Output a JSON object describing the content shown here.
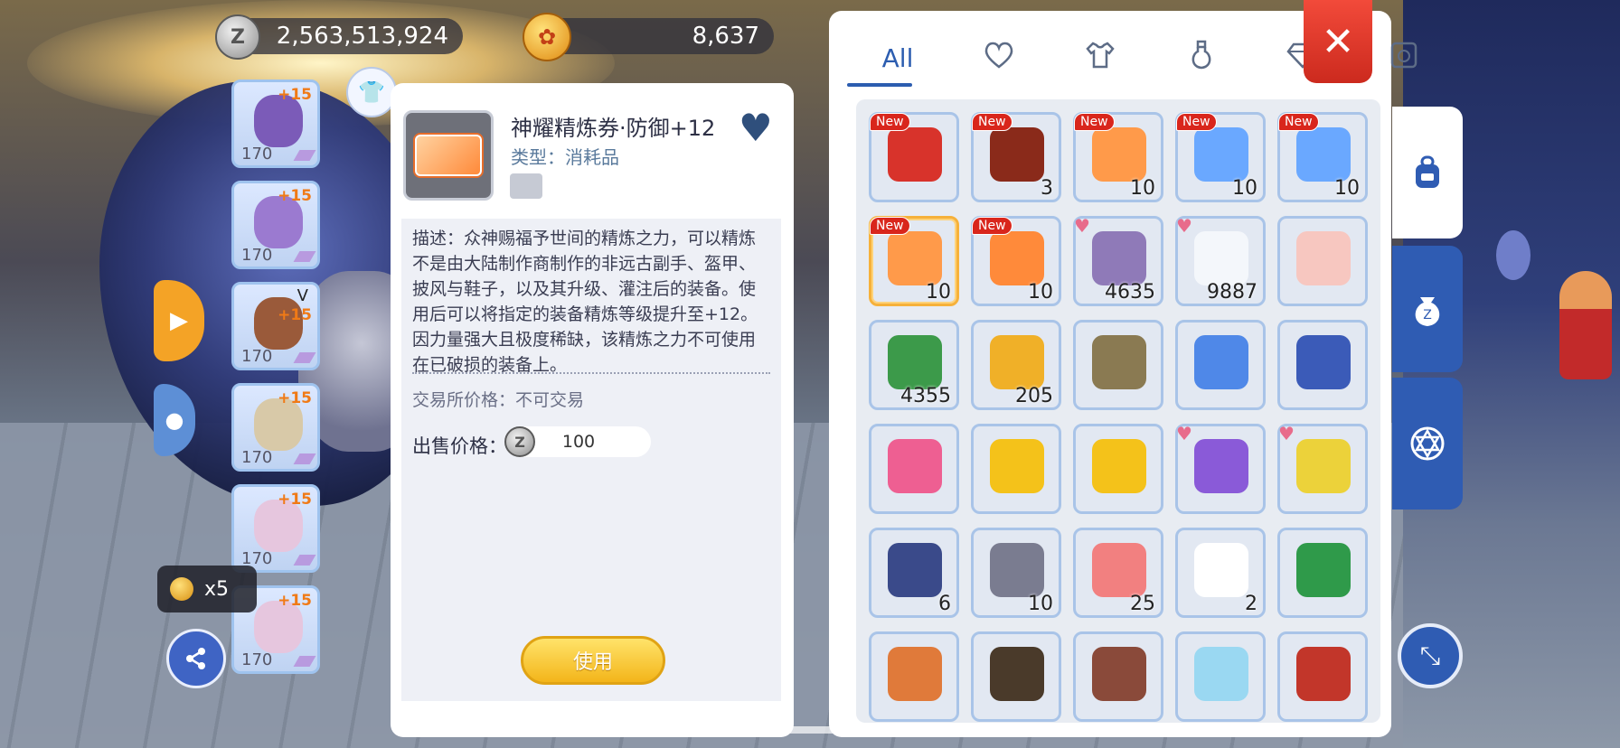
{
  "currency": {
    "zeny_icon": "zeny-coin-icon",
    "zeny_glyph": "Z",
    "zeny": "2,563,513,924",
    "gold_icon": "gold-coin-icon",
    "gold": "8,637"
  },
  "equipment": [
    {
      "name": "equip-slot-headgear",
      "level": "170",
      "refine": "+15",
      "color": "#7b5bb8"
    },
    {
      "name": "equip-slot-armor",
      "level": "170",
      "refine": "+15",
      "color": "#9b7ad0"
    },
    {
      "name": "equip-slot-garment",
      "level": "170",
      "refine": "+15",
      "mark": "V",
      "color": "#9a5a3a"
    },
    {
      "name": "equip-slot-shoes",
      "level": "170",
      "refine": "+15",
      "color": "#d8c9a8"
    },
    {
      "name": "equip-slot-accessory-1",
      "level": "170",
      "refine": "+15",
      "color": "#e6c6de"
    },
    {
      "name": "equip-slot-accessory-2",
      "level": "170",
      "refine": "+15",
      "color": "#e6c6de"
    }
  ],
  "coin_tip": {
    "count": "x5"
  },
  "detail": {
    "title": "神耀精炼券·防御+12",
    "type": "类型：消耗品",
    "description": "描述：众神赐福予世间的精炼之力，可以精炼不是由大陆制作商制作的非远古副手、盔甲、披风与鞋子，以及其升级、灌注后的装备。使用后可以将指定的装备精炼等级提升至+12。因力量强大且极度稀缺，该精炼之力不可使用在已破损的装备上。",
    "trade": "交易所价格：不可交易",
    "sell_label": "出售价格：",
    "sell_price": "100",
    "use_label": "使用"
  },
  "inventory": {
    "tabs": [
      {
        "name": "tab-all",
        "label": "All",
        "icon": ""
      },
      {
        "name": "tab-favorites",
        "label": "",
        "icon": "heart-icon"
      },
      {
        "name": "tab-equipment",
        "label": "",
        "icon": "shirt-icon"
      },
      {
        "name": "tab-consumables",
        "label": "",
        "icon": "potion-icon"
      },
      {
        "name": "tab-gems",
        "label": "",
        "icon": "diamond-icon"
      },
      {
        "name": "tab-cards",
        "label": "",
        "icon": "card-icon"
      }
    ],
    "close_icon": "close-icon",
    "items": [
      {
        "new": true,
        "fav": false,
        "qty": "",
        "color": "#d8332b"
      },
      {
        "new": true,
        "fav": false,
        "qty": "3",
        "color": "#8a2a1a"
      },
      {
        "new": true,
        "fav": false,
        "qty": "10",
        "color": "#ff9a4a"
      },
      {
        "new": true,
        "fav": false,
        "qty": "10",
        "color": "#6aa8ff"
      },
      {
        "new": true,
        "fav": false,
        "qty": "10",
        "color": "#6aa8ff"
      },
      {
        "new": true,
        "fav": false,
        "qty": "10",
        "color": "#ff9a4a",
        "selected": true
      },
      {
        "new": true,
        "fav": false,
        "qty": "10",
        "color": "#ff8a3a"
      },
      {
        "new": false,
        "fav": true,
        "qty": "4635",
        "color": "#8f7ab8"
      },
      {
        "new": false,
        "fav": true,
        "qty": "9887",
        "color": "#f4f7fb"
      },
      {
        "new": false,
        "fav": false,
        "qty": "",
        "color": "#f7c7c0"
      },
      {
        "new": false,
        "fav": false,
        "qty": "4355",
        "color": "#3c9a4a"
      },
      {
        "new": false,
        "fav": false,
        "qty": "205",
        "color": "#f0b028"
      },
      {
        "new": false,
        "fav": false,
        "qty": "",
        "color": "#8a7a52"
      },
      {
        "new": false,
        "fav": false,
        "qty": "",
        "color": "#4f88e8"
      },
      {
        "new": false,
        "fav": false,
        "qty": "",
        "color": "#3b5bb8"
      },
      {
        "new": false,
        "fav": false,
        "qty": "",
        "color": "#ee5f92"
      },
      {
        "new": false,
        "fav": false,
        "qty": "",
        "color": "#f4c21a"
      },
      {
        "new": false,
        "fav": false,
        "qty": "",
        "color": "#f4c21a"
      },
      {
        "new": false,
        "fav": true,
        "qty": "",
        "color": "#8a5ad8"
      },
      {
        "new": false,
        "fav": true,
        "qty": "",
        "color": "#ecd23a"
      },
      {
        "new": false,
        "fav": false,
        "qty": "6",
        "color": "#3a4a8a"
      },
      {
        "new": false,
        "fav": false,
        "qty": "10",
        "color": "#7a7c90"
      },
      {
        "new": false,
        "fav": false,
        "qty": "25",
        "color": "#f28080"
      },
      {
        "new": false,
        "fav": false,
        "qty": "2",
        "color": "#ffffff"
      },
      {
        "new": false,
        "fav": false,
        "qty": "",
        "color": "#2f9a4a"
      },
      {
        "new": false,
        "fav": false,
        "qty": "",
        "color": "#e07a3a"
      },
      {
        "new": false,
        "fav": false,
        "qty": "",
        "color": "#4a3a2a"
      },
      {
        "new": false,
        "fav": false,
        "qty": "",
        "color": "#8a4a3a"
      },
      {
        "new": false,
        "fav": false,
        "qty": "",
        "color": "#9ad8f2"
      },
      {
        "new": false,
        "fav": false,
        "qty": "",
        "color": "#c2362a"
      }
    ],
    "new_label": "New"
  },
  "side_tabs": [
    {
      "name": "bag-tab",
      "icon": "backpack-icon"
    },
    {
      "name": "zeny-bag-tab",
      "icon": "zeny-bag-icon"
    },
    {
      "name": "magic-circle-tab",
      "icon": "hexagram-icon"
    }
  ]
}
